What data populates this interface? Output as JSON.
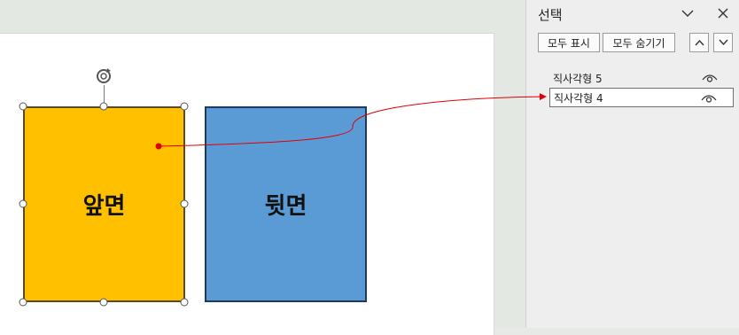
{
  "slide": {
    "shapes": [
      {
        "label": "앞면",
        "fill": "#ffc000",
        "border": "#5b4a22"
      },
      {
        "label": "뒷면",
        "fill": "#5b9bd5",
        "border": "#1f3a5f"
      }
    ],
    "connector_color": "#e00000"
  },
  "pane": {
    "title": "선택",
    "collapse_icon": "chevron-down-icon",
    "close_icon": "close-icon",
    "show_all_label": "모두 표시",
    "hide_all_label": "모두 숨기기",
    "move_up_icon": "chevron-up-icon",
    "move_down_icon": "chevron-down-icon",
    "layers": [
      {
        "label": "직사각형 5",
        "visible": true,
        "selected": false
      },
      {
        "label": "직사각형 4",
        "visible": true,
        "selected": true
      }
    ]
  }
}
